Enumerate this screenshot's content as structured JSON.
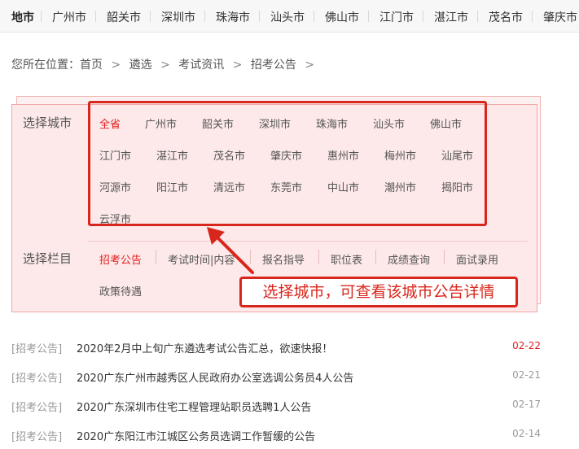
{
  "topnav": {
    "items": [
      "地市",
      "广州市",
      "韶关市",
      "深圳市",
      "珠海市",
      "汕头市",
      "佛山市",
      "江门市",
      "湛江市",
      "茂名市",
      "肇庆市"
    ]
  },
  "breadcrumb": {
    "prefix": "您所在位置：",
    "items": [
      "首页",
      "遴选",
      "考试资讯",
      "招考公告"
    ],
    "separator": ">"
  },
  "filter": {
    "city_label": "选择城市",
    "cities": [
      "全省",
      "广州市",
      "韶关市",
      "深圳市",
      "珠海市",
      "汕头市",
      "佛山市",
      "江门市",
      "湛江市",
      "茂名市",
      "肇庆市",
      "惠州市",
      "梅州市",
      "汕尾市",
      "河源市",
      "阳江市",
      "清远市",
      "东莞市",
      "中山市",
      "潮州市",
      "揭阳市",
      "云浮市"
    ],
    "active_city": "全省",
    "category_label": "选择栏目",
    "categories": [
      "招考公告",
      "考试时间|内容",
      "报名指导",
      "职位表",
      "成绩查询",
      "面试录用",
      "政策待遇"
    ],
    "active_category": "招考公告",
    "callout": "选择城市，可查看该城市公告详情"
  },
  "news": [
    {
      "tag": "[招考公告]",
      "title": "2020年2月中上旬广东遴选考试公告汇总，欲速快报！",
      "date": "02-22",
      "hot": true
    },
    {
      "tag": "[招考公告]",
      "title": "2020广东广州市越秀区人民政府办公室选调公务员4人公告",
      "date": "02-21",
      "hot": false
    },
    {
      "tag": "[招考公告]",
      "title": "2020广东深圳市住宅工程管理站职员选聘1人公告",
      "date": "02-17",
      "hot": false
    },
    {
      "tag": "[招考公告]",
      "title": "2020广东阳江市江城区公务员选调工作暂缓的公告",
      "date": "02-14",
      "hot": false
    }
  ],
  "colors": {
    "accent": "#e02020",
    "highlight": "#d9261c",
    "panel_bg": "#fde9e9"
  }
}
